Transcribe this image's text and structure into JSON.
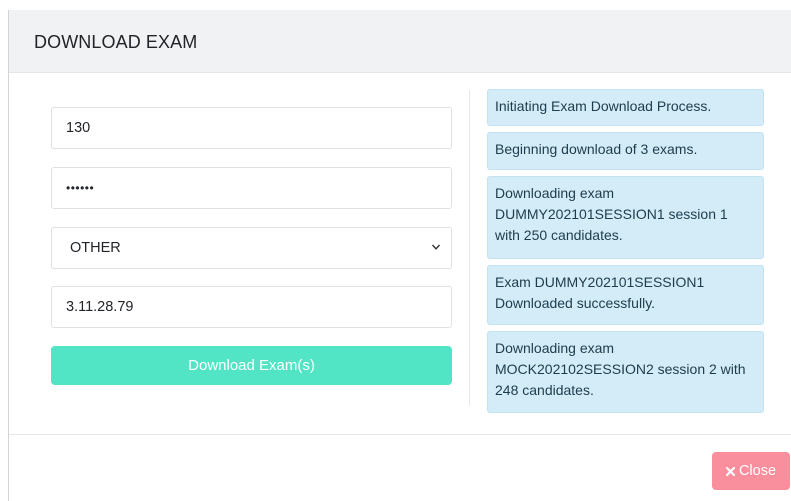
{
  "modal": {
    "title": "DOWNLOAD EXAM"
  },
  "form": {
    "centre_code": "130",
    "password_mask": "••••••",
    "exam_type": "OTHER",
    "exam_type_options": [
      "OTHER"
    ],
    "version": "3.11.28.79",
    "download_label": "Download Exam(s)"
  },
  "log": [
    "Initiating Exam Download Process.",
    "Beginning download of 3 exams.",
    "Downloading exam DUMMY202101SESSION1 session 1 with 250 candidates.",
    "Exam DUMMY202101SESSION1 Downloaded successfully.",
    "Downloading exam MOCK202102SESSION2 session 2 with 248 candidates."
  ],
  "footer": {
    "close_label": "Close",
    "close_icon": "times-icon"
  },
  "colors": {
    "download_button": "#48e4c3",
    "close_button": "#f98e9c",
    "log_background": "#d4ecf7",
    "header_background": "#f1f2f4"
  }
}
